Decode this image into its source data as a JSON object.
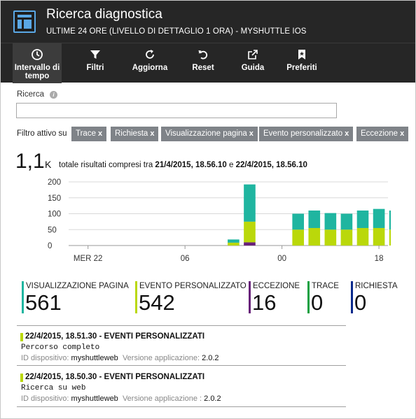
{
  "header": {
    "title": "Ricerca diagnostica",
    "subtitle": "ULTIME 24 ORE (LIVELLO DI DETTAGLIO 1 ORA) - MYSHUTTLE IOS"
  },
  "toolbar": {
    "items": [
      {
        "label": "Intervallo di tempo",
        "icon": "clock-icon"
      },
      {
        "label": "Filtri",
        "icon": "filter-icon"
      },
      {
        "label": "Aggiorna",
        "icon": "refresh-icon"
      },
      {
        "label": "Reset",
        "icon": "undo-icon"
      },
      {
        "label": "Guida",
        "icon": "external-link-icon"
      },
      {
        "label": "Preferiti",
        "icon": "bookmark-star-icon"
      }
    ]
  },
  "search": {
    "label": "Ricerca",
    "value": "",
    "placeholder": ""
  },
  "filters": {
    "label": "Filtro attivo su",
    "chips": [
      "Trace",
      "Richiesta",
      "Visualizzazione pagina",
      "Evento personalizzato",
      "Eccezione"
    ]
  },
  "total": {
    "value": "1,1",
    "unit": "K",
    "text_prefix": "totale risultati compresi tra",
    "from": "21/4/2015, 18.56.10",
    "connector": "e",
    "to": "22/4/2015, 18.56.10"
  },
  "chart_data": {
    "type": "bar",
    "stacked": true,
    "y_ticks": [
      "200",
      "150",
      "100",
      "50",
      "0"
    ],
    "ylim": [
      0,
      200
    ],
    "x_tick_labels": [
      {
        "label": "MER 22",
        "slot": 6
      },
      {
        "label": "06",
        "slot": 12
      },
      {
        "label": "00",
        "slot": 18
      },
      {
        "label": "18",
        "slot": 24
      }
    ],
    "slots": 26,
    "colors": {
      "visualizzazione_pagina": "#1fb5a0",
      "evento_personalizzato": "#bad80a",
      "eccezione": "#68217a"
    },
    "series": [
      {
        "name": "Eccezione",
        "key": "eccezione",
        "values": [
          0,
          0,
          0,
          0,
          0,
          0,
          0,
          0,
          0,
          0,
          0,
          0,
          0,
          0,
          0,
          0,
          10,
          0,
          0,
          0,
          0,
          0,
          0,
          0,
          0,
          0
        ]
      },
      {
        "name": "Evento personalizzato",
        "key": "evento_personalizzato",
        "values": [
          0,
          0,
          0,
          0,
          0,
          0,
          0,
          0,
          0,
          0,
          0,
          0,
          0,
          0,
          0,
          9,
          65,
          0,
          0,
          50,
          55,
          50,
          50,
          55,
          55,
          50,
          48,
          48
        ]
      },
      {
        "name": "Visualizzazione pagina",
        "key": "visualizzazione_pagina",
        "values": [
          0,
          0,
          0,
          0,
          0,
          0,
          0,
          0,
          0,
          0,
          0,
          0,
          0,
          0,
          0,
          10,
          117,
          0,
          0,
          50,
          55,
          52,
          50,
          55,
          60,
          60,
          55,
          48
        ]
      }
    ]
  },
  "stats": [
    {
      "label": "VISUALIZZAZIONE PAGINA",
      "value": "561",
      "color": "#1fb5a0"
    },
    {
      "label": "EVENTO PERSONALIZZATO",
      "value": "542",
      "color": "#bad80a"
    },
    {
      "label": "ECCEZIONE",
      "value": "16",
      "color": "#68217a"
    },
    {
      "label": "TRACE",
      "value": "0",
      "color": "#10a040"
    },
    {
      "label": "RICHIESTA",
      "value": "0",
      "color": "#0a2a8c"
    }
  ],
  "events": [
    {
      "title": "22/4/2015, 18.51.30 - EVENTI PERSONALIZZATI",
      "name": "Percorso completo",
      "device_label": "ID dispositivo:",
      "device": "myshuttleweb",
      "version_label": "Versione applicazione:",
      "version": "2.0.2"
    },
    {
      "title": "22/4/2015, 18.50.30 - EVENTI PERSONALIZZATI",
      "name": "Ricerca su web",
      "device_label": "ID dispositivo:",
      "device": "myshuttleweb",
      "version_label": "Versione applicazione :",
      "version": "2.0.2"
    }
  ]
}
